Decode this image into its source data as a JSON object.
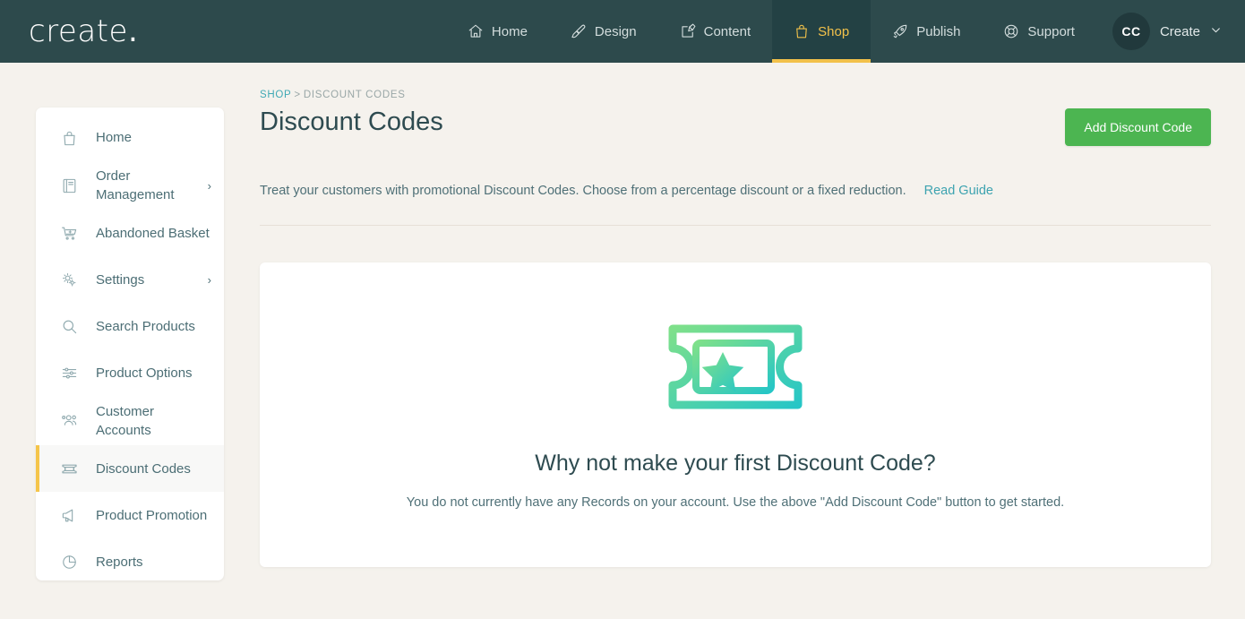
{
  "header": {
    "logo_text": "create",
    "logo_dot": ".",
    "nav": [
      {
        "label": "Home",
        "icon": "home-icon",
        "active": false
      },
      {
        "label": "Design",
        "icon": "paintbrush-icon",
        "active": false
      },
      {
        "label": "Content",
        "icon": "edit-square-icon",
        "active": false
      },
      {
        "label": "Shop",
        "icon": "shopping-bag-icon",
        "active": true
      },
      {
        "label": "Publish",
        "icon": "rocket-icon",
        "active": false
      },
      {
        "label": "Support",
        "icon": "lifebuoy-icon",
        "active": false
      }
    ],
    "account": {
      "initials": "CC",
      "name": "Create",
      "chevron": "chevron-down-icon"
    },
    "colors": {
      "background": "#2d4a4c",
      "active_background": "#234144",
      "accent_yellow": "#f2c14a"
    }
  },
  "sidebar": {
    "items": [
      {
        "label": "Home",
        "icon": "shopping-bag-icon",
        "expandable": false,
        "active": false
      },
      {
        "label": "Order Management",
        "icon": "book-icon",
        "expandable": true,
        "active": false
      },
      {
        "label": "Abandoned Basket",
        "icon": "shopping-cart-icon",
        "expandable": false,
        "active": false
      },
      {
        "label": "Settings",
        "icon": "gears-icon",
        "expandable": true,
        "active": false
      },
      {
        "label": "Search Products",
        "icon": "search-icon",
        "expandable": false,
        "active": false
      },
      {
        "label": "Product Options",
        "icon": "sliders-icon",
        "expandable": false,
        "active": false
      },
      {
        "label": "Customer Accounts",
        "icon": "users-icon",
        "expandable": false,
        "active": false
      },
      {
        "label": "Discount Codes",
        "icon": "ticket-icon",
        "expandable": false,
        "active": true
      },
      {
        "label": "Product Promotion",
        "icon": "megaphone-icon",
        "expandable": false,
        "active": false
      },
      {
        "label": "Reports",
        "icon": "pie-chart-icon",
        "expandable": false,
        "active": false
      }
    ],
    "chevron_glyph": "›",
    "active_accent_color": "#f5c54a"
  },
  "main": {
    "breadcrumb": {
      "root": "SHOP",
      "separator": ">",
      "current": "DISCOUNT CODES"
    },
    "page_title": "Discount Codes",
    "add_button_label": "Add Discount Code",
    "add_button_color": "#4cb551",
    "description": "Treat your customers with promotional Discount Codes. Choose from a percentage discount or a fixed reduction.",
    "read_guide_label": "Read Guide",
    "empty_state": {
      "icon": "ticket-star-icon",
      "icon_gradient_from": "#7ee08a",
      "icon_gradient_to": "#2ec4b6",
      "title": "Why not make your first Discount Code?",
      "subtitle": "You do not currently have any Records on your account. Use the above \"Add Discount Code\" button to get started."
    }
  }
}
